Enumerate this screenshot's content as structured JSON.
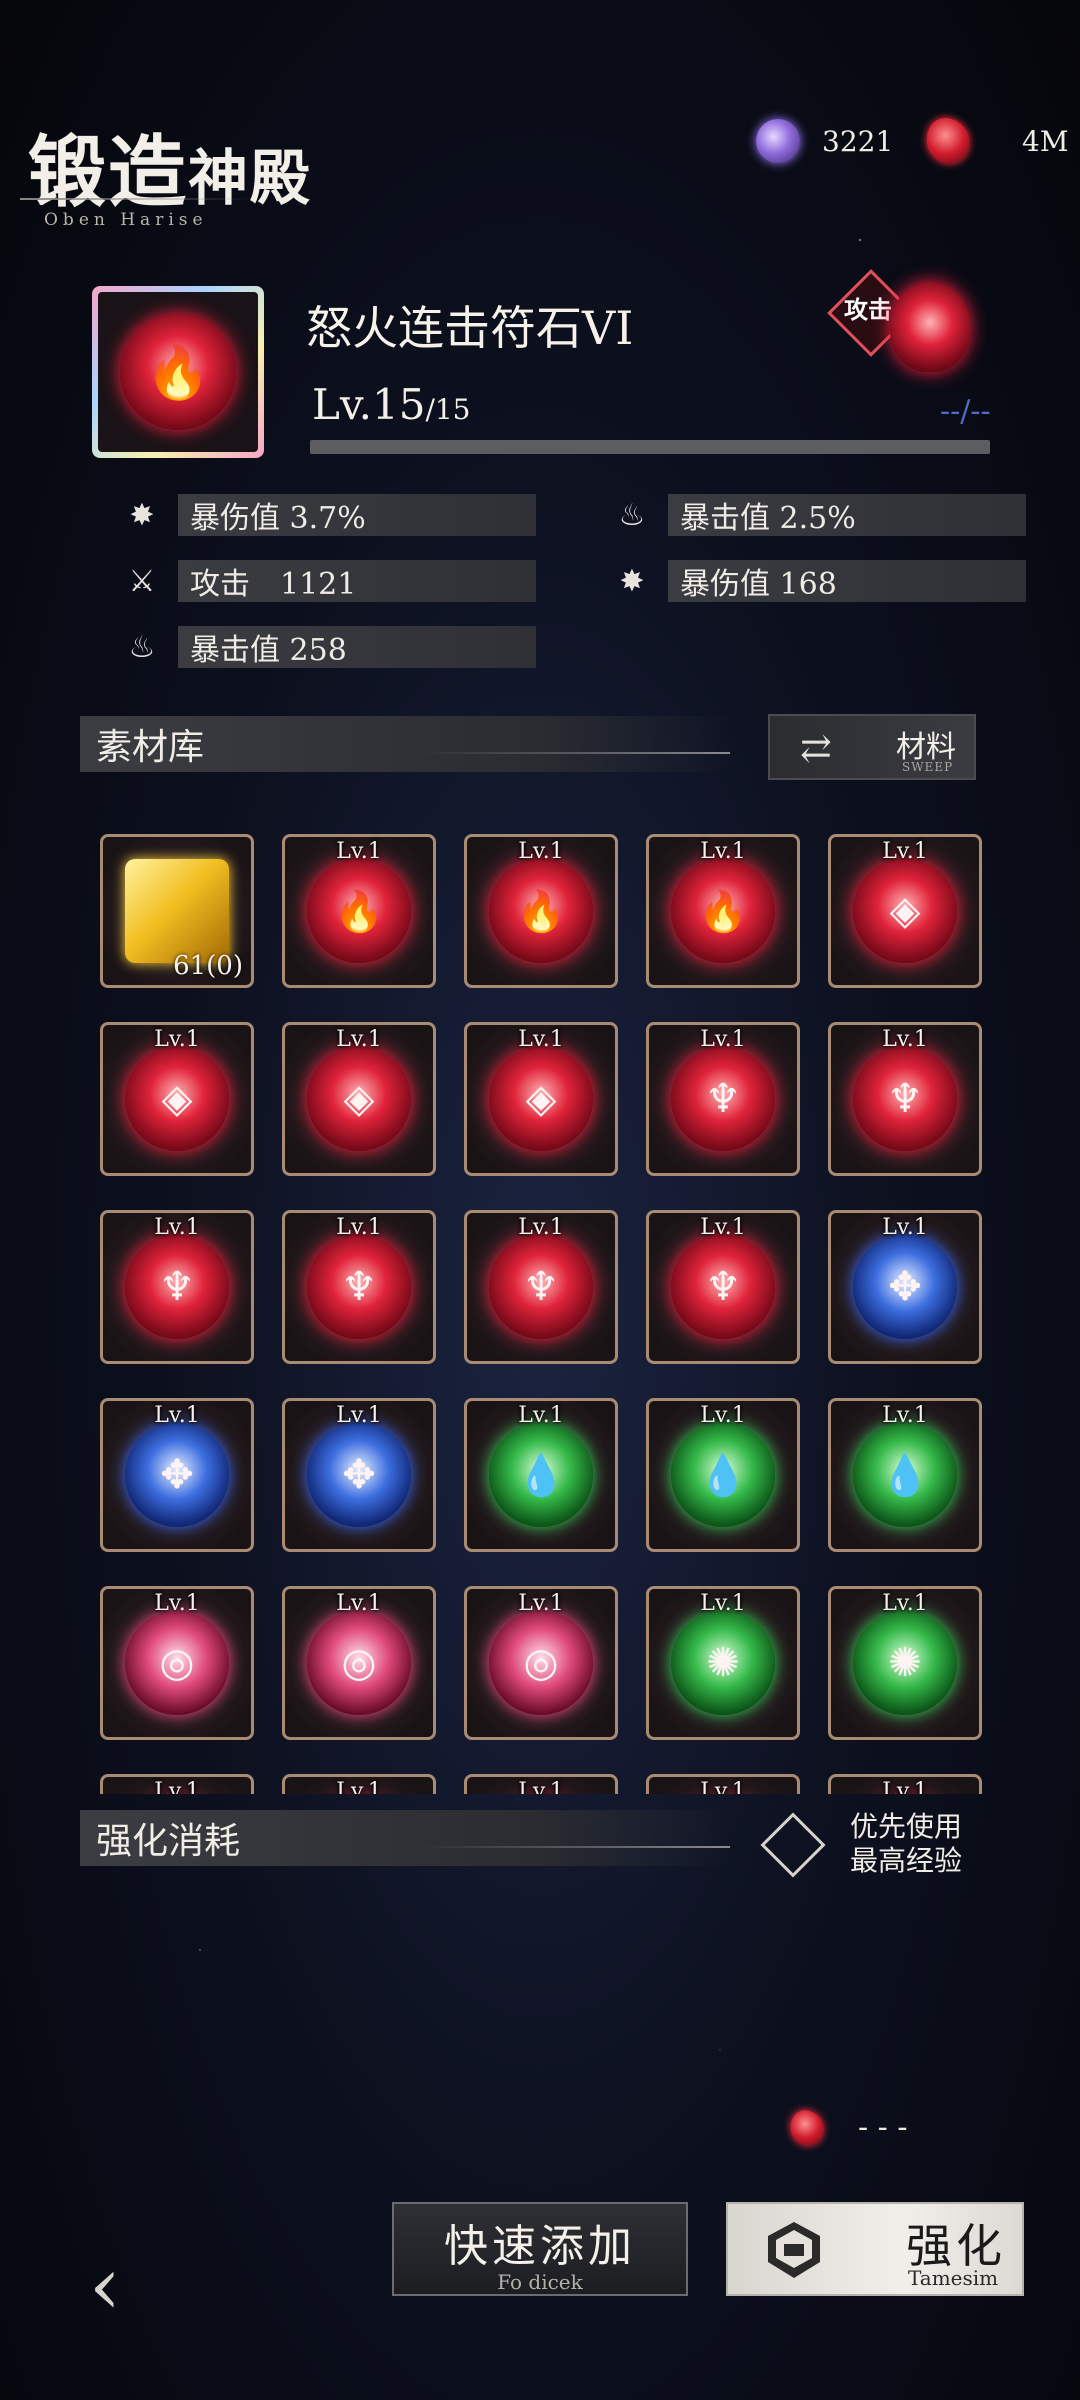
{
  "header": {
    "title_part1": "锻造",
    "title_part2": "神殿",
    "subtitle": "Oben Harise",
    "currency_crystal": "3221",
    "currency_ruby": "4M"
  },
  "rune": {
    "name": "怒火连击符石VI",
    "level": "Lv.15",
    "level_max": "/15",
    "exp_text": "--/--",
    "exp_progress": 0.0,
    "type_tag": "攻击"
  },
  "stats": {
    "left": [
      {
        "icon": "crit-damage-icon",
        "text": "暴伤值 3.7%"
      },
      {
        "icon": "sword-icon",
        "text": "攻击　1121"
      },
      {
        "icon": "crit-flame-icon",
        "text": "暴击值 258"
      }
    ],
    "right": [
      {
        "icon": "crit-flame-icon",
        "text": "暴击值 2.5%"
      },
      {
        "icon": "crit-damage-icon",
        "text": "暴伤值 168"
      }
    ]
  },
  "materials": {
    "section_title": "素材库",
    "button_label": "材料",
    "button_sub": "SWEEP",
    "items": [
      {
        "type": "exp-cube",
        "count": "61(0)"
      },
      {
        "type": "flame",
        "lv": "Lv.1"
      },
      {
        "type": "flame",
        "lv": "Lv.1"
      },
      {
        "type": "flame",
        "lv": "Lv.1"
      },
      {
        "type": "diamond-flame",
        "lv": "Lv.1"
      },
      {
        "type": "diamond-flame",
        "lv": "Lv.1"
      },
      {
        "type": "diamond-flame",
        "lv": "Lv.1"
      },
      {
        "type": "diamond-flame",
        "lv": "Lv.1"
      },
      {
        "type": "tree",
        "lv": "Lv.1"
      },
      {
        "type": "tree",
        "lv": "Lv.1"
      },
      {
        "type": "tree",
        "lv": "Lv.1"
      },
      {
        "type": "tree",
        "lv": "Lv.1"
      },
      {
        "type": "tree",
        "lv": "Lv.1"
      },
      {
        "type": "tree",
        "lv": "Lv.1"
      },
      {
        "type": "blue-cross",
        "lv": "Lv.1"
      },
      {
        "type": "blue-cross",
        "lv": "Lv.1"
      },
      {
        "type": "blue-cross",
        "lv": "Lv.1"
      },
      {
        "type": "green-drop",
        "lv": "Lv.1"
      },
      {
        "type": "green-drop",
        "lv": "Lv.1"
      },
      {
        "type": "green-drop",
        "lv": "Lv.1"
      },
      {
        "type": "pink-swirl",
        "lv": "Lv.1"
      },
      {
        "type": "pink-swirl",
        "lv": "Lv.1"
      },
      {
        "type": "pink-swirl",
        "lv": "Lv.1"
      },
      {
        "type": "green-sun",
        "lv": "Lv.1"
      },
      {
        "type": "green-sun",
        "lv": "Lv.1"
      },
      {
        "type": "partial",
        "lv": "Lv.1"
      },
      {
        "type": "partial",
        "lv": "Lv.1"
      },
      {
        "type": "partial",
        "lv": "Lv.1"
      },
      {
        "type": "partial",
        "lv": "Lv.1"
      },
      {
        "type": "partial",
        "lv": "Lv.1"
      }
    ]
  },
  "consume": {
    "section_title": "强化消耗",
    "prefer_line1": "优先使用",
    "prefer_line2": "最高经验",
    "cost_value": "- - -"
  },
  "buttons": {
    "quick_add": "快速添加",
    "quick_add_sub": "Fo dicek",
    "enhance": "强化",
    "enhance_sub": "Tamesim"
  }
}
